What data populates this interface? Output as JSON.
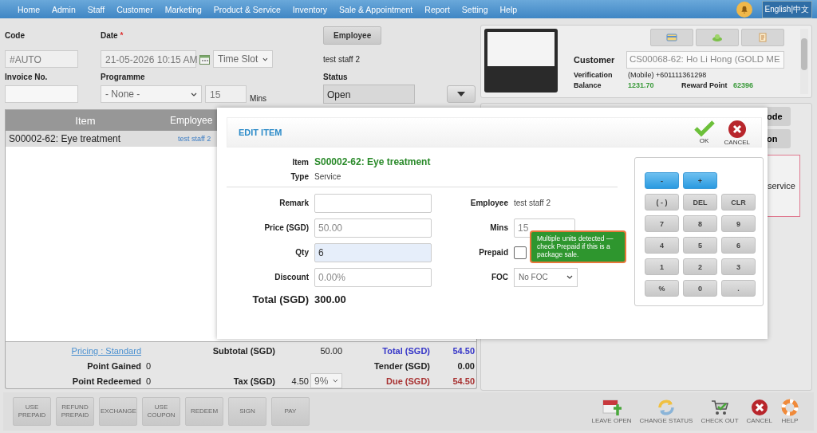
{
  "nav": {
    "items": [
      "Home",
      "Admin",
      "Staff",
      "Customer",
      "Marketing",
      "Product & Service",
      "Inventory",
      "Sale & Appointment",
      "Report",
      "Setting",
      "Help"
    ],
    "language": "English|中文"
  },
  "form": {
    "code": {
      "label": "Code",
      "value": "#AUTO"
    },
    "date": {
      "label": "Date",
      "required": "*",
      "value": "21-05-2026 10:15 AM"
    },
    "time_slot": "Time Slot",
    "employee_button": "Employee",
    "employee_value": "test staff 2",
    "invoice": {
      "label": "Invoice No."
    },
    "programme": {
      "label": "Programme",
      "value": "- None -"
    },
    "mins": {
      "value": "15",
      "label": "Mins"
    },
    "status": {
      "label": "Status",
      "value": "Open"
    }
  },
  "table": {
    "columns": [
      "Item",
      "Employee"
    ],
    "rows": [
      {
        "item": "S00002-62: Eye treatment",
        "employee": "test staff 2",
        "selected": true
      }
    ]
  },
  "summary": {
    "pricing_link": "Pricing : Standard",
    "subtotal": {
      "label": "Subtotal (SGD)",
      "value": "50.00"
    },
    "point_gained": {
      "label": "Point Gained",
      "value": "0"
    },
    "point_redeemed": {
      "label": "Point Redeemed",
      "value": "0"
    },
    "tax": {
      "label": "Tax (SGD)",
      "value": "4.50",
      "rate": "9%"
    },
    "totals": [
      {
        "kind": "total",
        "label": "Total (SGD)",
        "value": "54.50"
      },
      {
        "kind": "tender",
        "label": "Tender (SGD)",
        "value": "0.00"
      },
      {
        "kind": "due",
        "label": "Due (SGD)",
        "value": "54.50"
      }
    ]
  },
  "actions": [
    "USE PREPAID",
    "REFUND PREPAID",
    "EXCHANGE",
    "USE COUPON",
    "REDEEM",
    "SIGN",
    "PAY"
  ],
  "tools": [
    {
      "kind": "leave_open",
      "label": "LEAVE OPEN"
    },
    {
      "kind": "change_status",
      "label": "CHANGE STATUS"
    },
    {
      "kind": "check_out",
      "label": "CHECK OUT"
    },
    {
      "kind": "cancel",
      "label": "CANCEL"
    },
    {
      "kind": "help",
      "label": "HELP"
    }
  ],
  "customer": {
    "label": "Customer",
    "value": "CS00068-62: Ho Li Hong (GOLD ME",
    "verification": {
      "label": "Verification",
      "value": "(Mobile) +601111361298"
    },
    "balance": {
      "label": "Balance",
      "value": "1231.70"
    },
    "reward": {
      "label": "Reward Point",
      "value": "62396"
    }
  },
  "right_panel": {
    "partial_buttons": [
      "ode",
      "on"
    ],
    "note": "service"
  },
  "edit_item": {
    "title": "EDIT ITEM",
    "ok": "OK",
    "cancel": "CANCEL",
    "item": {
      "label": "Item",
      "value": "S00002-62: Eye treatment"
    },
    "type": {
      "label": "Type",
      "value": "Service"
    },
    "left_fields": [
      {
        "label": "Remark",
        "focused": false
      },
      {
        "label": "Price (SGD)",
        "value": "50.00",
        "focused": false
      },
      {
        "label": "Qty",
        "value": "6",
        "focused": true
      },
      {
        "label": "Discount",
        "value": "0.00%",
        "focused": false
      }
    ],
    "right_fields": [
      {
        "kind": "text",
        "label": "Employee",
        "value": "test staff 2"
      },
      {
        "kind": "input",
        "label": "Mins",
        "value": "15"
      },
      {
        "kind": "checkbox",
        "label": "Prepaid",
        "checked": false
      },
      {
        "kind": "select",
        "label": "FOC",
        "value": "No FOC"
      }
    ],
    "total": {
      "label": "Total (SGD)",
      "value": "300.00"
    },
    "tooltip": "Multiple units detected — check Prepaid if this is a package sale.",
    "keypad": [
      {
        "kind": "step",
        "label": "-"
      },
      {
        "kind": "step",
        "label": "+"
      },
      {
        "kind": "key",
        "label": "( - )"
      },
      {
        "kind": "key",
        "label": "DEL"
      },
      {
        "kind": "key",
        "label": "CLR"
      },
      {
        "kind": "key",
        "label": "7"
      },
      {
        "kind": "key",
        "label": "8"
      },
      {
        "kind": "key",
        "label": "9"
      },
      {
        "kind": "key",
        "label": "4"
      },
      {
        "kind": "key",
        "label": "5"
      },
      {
        "kind": "key",
        "label": "6"
      },
      {
        "kind": "key",
        "label": "1"
      },
      {
        "kind": "key",
        "label": "2"
      },
      {
        "kind": "key",
        "label": "3"
      },
      {
        "kind": "key",
        "label": "%"
      },
      {
        "kind": "key",
        "label": "0"
      },
      {
        "kind": "key",
        "label": "."
      }
    ]
  }
}
